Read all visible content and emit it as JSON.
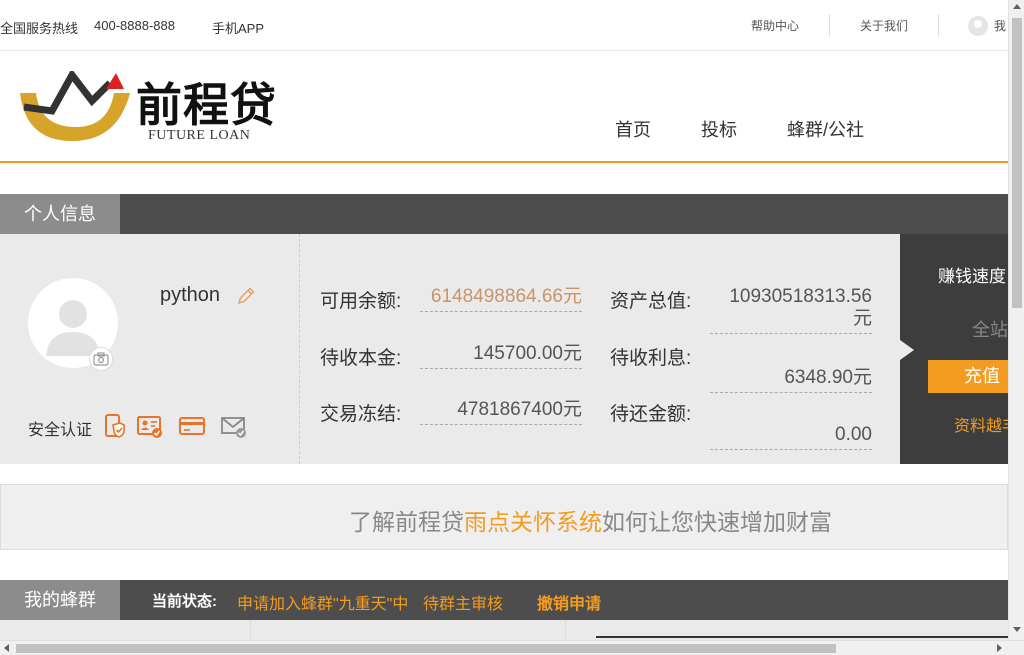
{
  "topbar": {
    "hotline_label": "全国服务热线",
    "hotline_number": "400-8888-888",
    "app_link": "手机APP",
    "help_link": "帮助中心",
    "about_link": "关于我们",
    "user_menu": "我"
  },
  "header": {
    "logo_text": "前程贷",
    "logo_subtitle": "FUTURE LOAN",
    "nav": [
      "首页",
      "投标",
      "蜂群/公社"
    ]
  },
  "personal": {
    "section_title": "个人信息",
    "username": "python",
    "auth_label": "安全认证",
    "icons": [
      "camera-icon",
      "edit-pencil-icon",
      "phone-verify-icon",
      "id-card-icon",
      "bank-card-icon",
      "email-icon"
    ],
    "fields": {
      "available_label": "可用余额:",
      "available_value": "6148498864.66元",
      "total_assets_label": "资产总值:",
      "total_assets_value_line1": "10930518313.56",
      "total_assets_value_line2": "元",
      "pending_principal_label": "待收本金:",
      "pending_principal_value": "145700.00元",
      "pending_interest_label": "待收利息:",
      "pending_interest_value": "6348.90元",
      "frozen_label": "交易冻结:",
      "frozen_value": "4781867400元",
      "repay_label": "待还金额:",
      "repay_value": "0.00"
    },
    "earn_panel": {
      "title": "赚钱速度",
      "whole_site": "全站",
      "recharge_button": "充值",
      "more_text": "资料越丰"
    }
  },
  "banner": {
    "prefix": "了解前程贷",
    "highlight": "雨点关怀系统",
    "suffix": "如何让您快速增加财富"
  },
  "hive": {
    "section_title": "我的蜂群",
    "status_label": "当前状态:",
    "status_text": "申请加入蜂群\"九重天\"中",
    "status_review": "待群主审核",
    "cancel_link": "撤销申请"
  },
  "colors": {
    "accent": "#f39c1f",
    "dark_bar": "#4d4d4d",
    "tab_gray": "#8c8c8c",
    "panel_bg": "#eaeaea",
    "balance_color": "#c8956a"
  }
}
